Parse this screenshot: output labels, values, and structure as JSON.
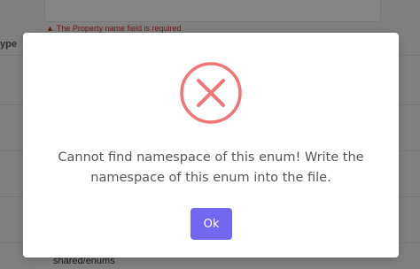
{
  "background": {
    "error_text": "The Property name field is required",
    "column_label": "ype",
    "bottom_text": "shared/enums"
  },
  "dialog": {
    "icon": "error-x-circle-icon",
    "icon_color": "#f27474",
    "message": "Cannot find namespace of this enum! Write the namespace of this enum into the file.",
    "ok_label": "Ok",
    "ok_color": "#7367f0"
  }
}
